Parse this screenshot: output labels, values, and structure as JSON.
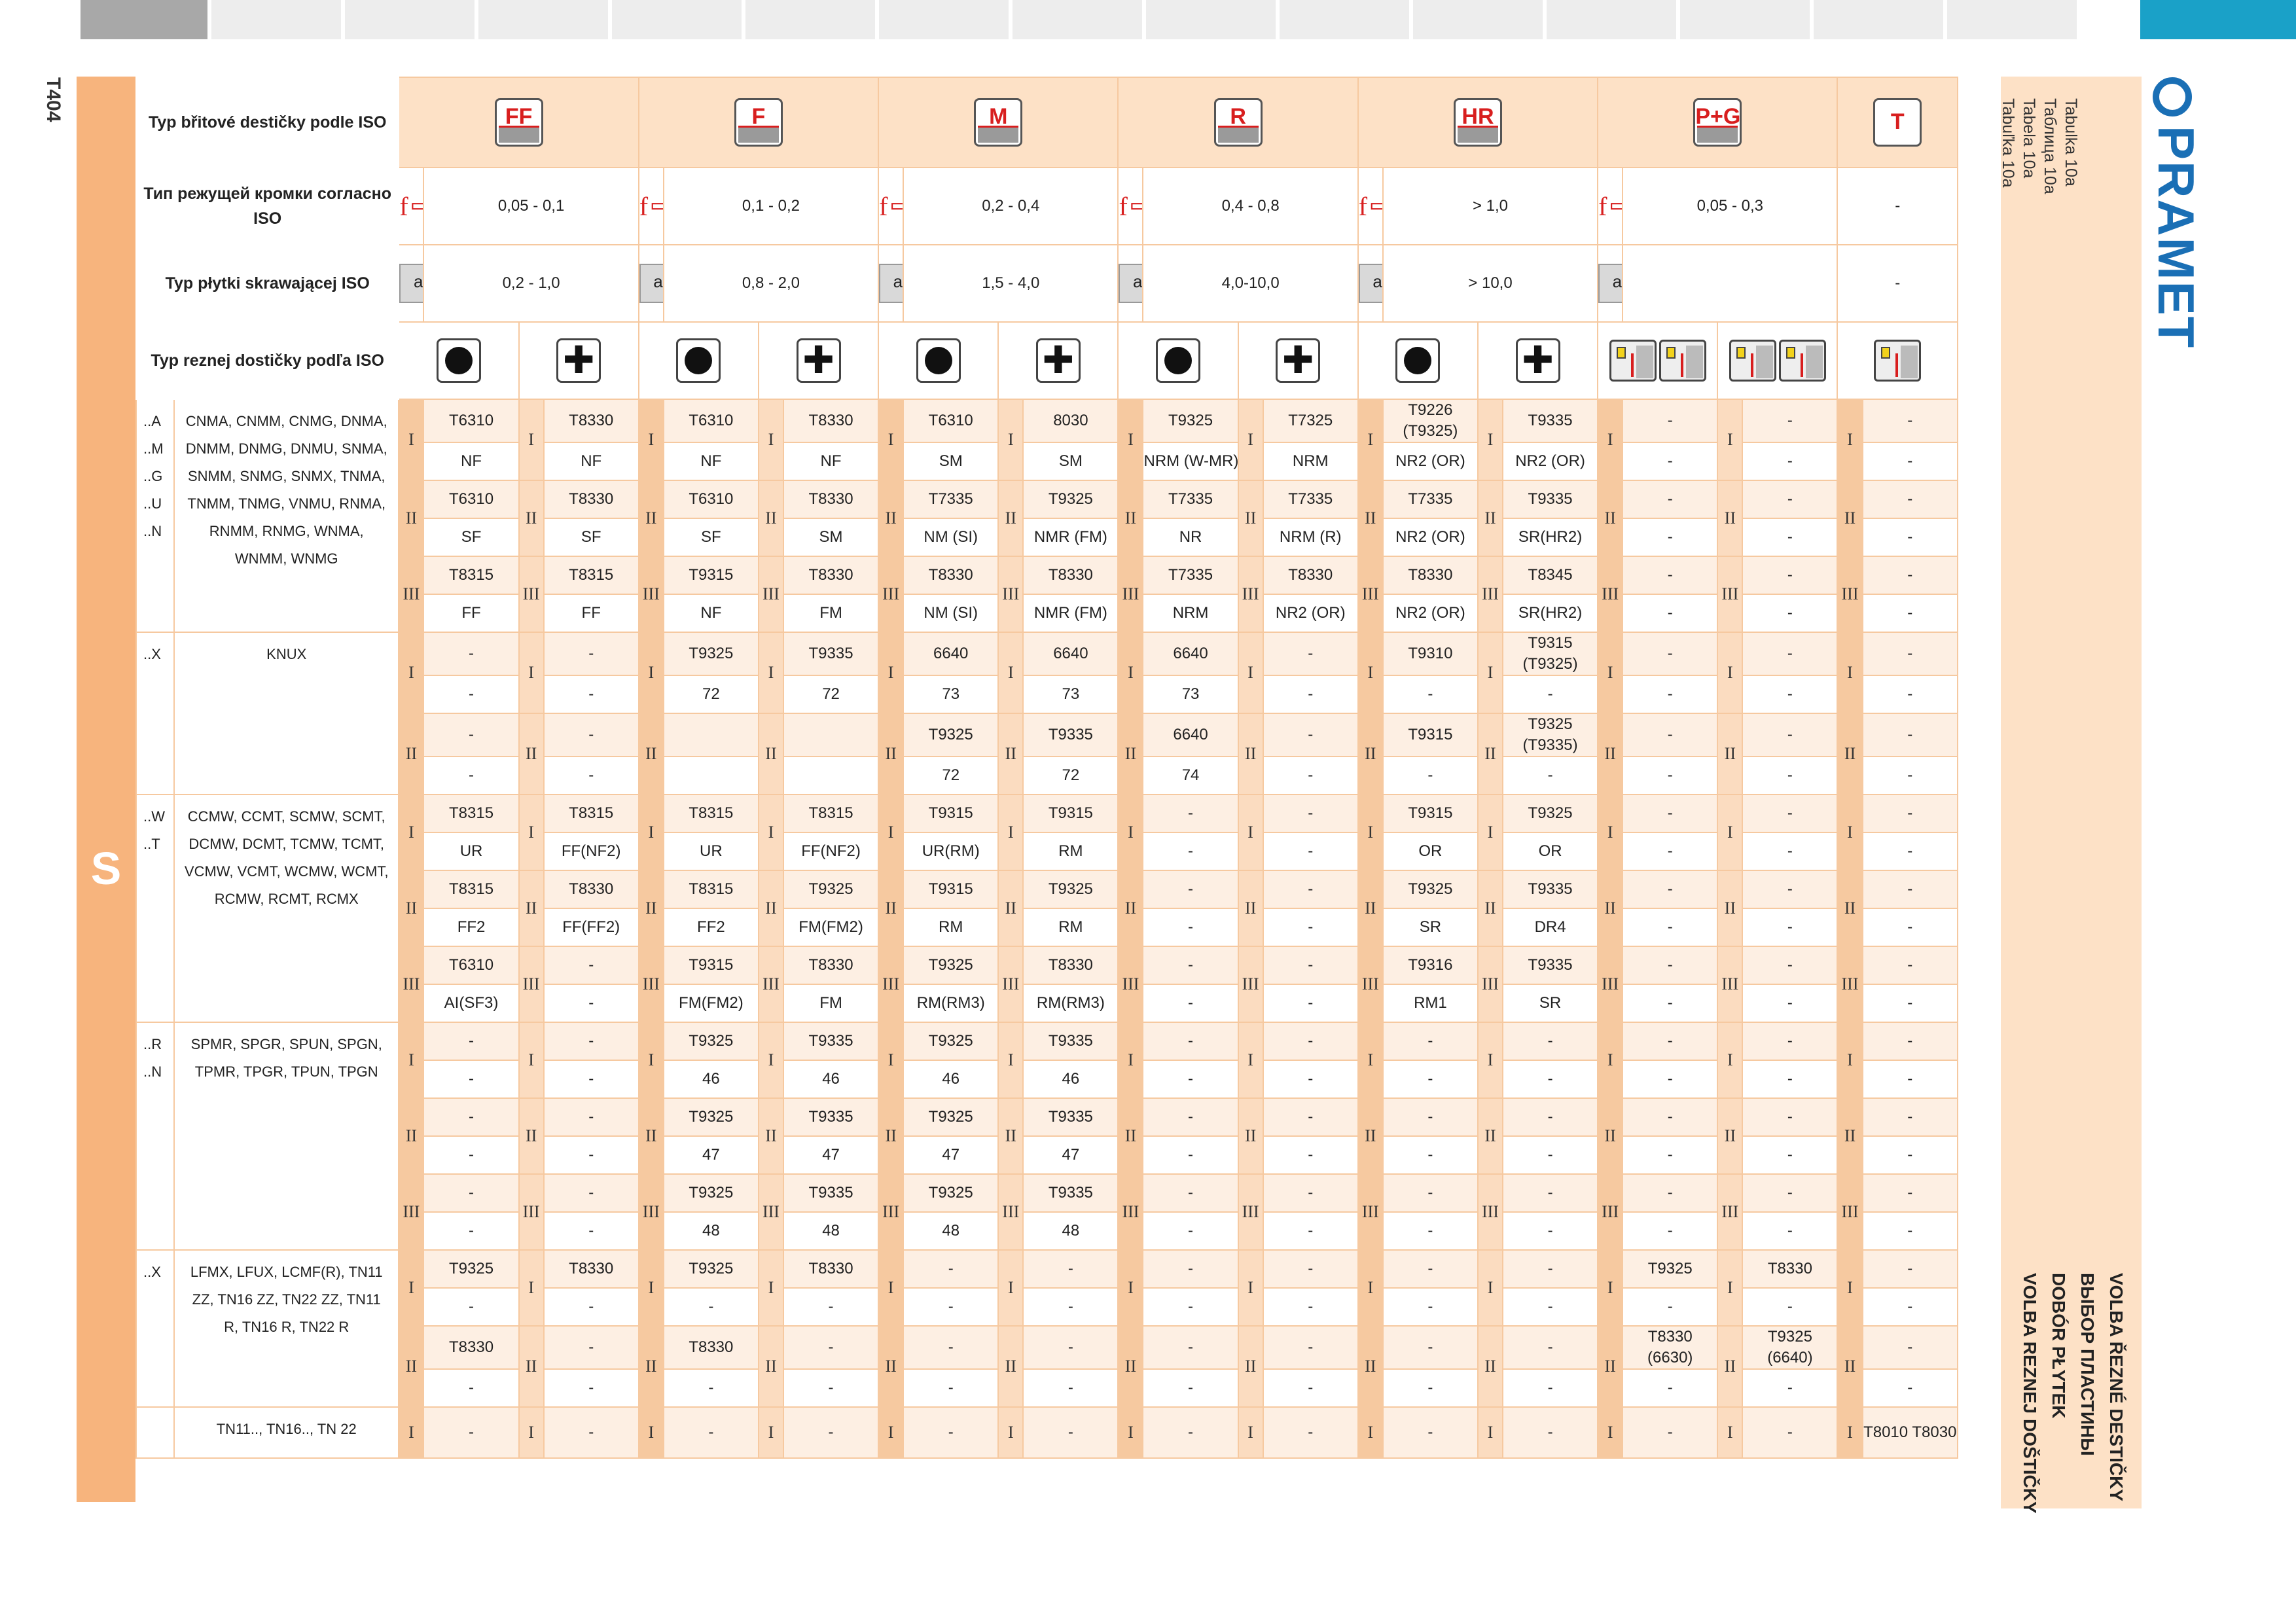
{
  "page": {
    "number": "T404",
    "side_letter": "S"
  },
  "brand": {
    "name": "PRAMET",
    "color": "#1a6fb5",
    "accent": "#1aa1c8",
    "band": "#f7b47d",
    "tint": "#fde1c6"
  },
  "table_refs": [
    "Tabulka 10a",
    "Таблица 10а",
    "Tabela 10a",
    "Tabuľka 10a"
  ],
  "section_titles": [
    "VOLBA ŘEZNÉ DESTIČKY",
    "ВЫБОР ПЛАСТИНЫ",
    "DOBÓR PŁYTEK",
    "VOLBA REZNEJ DOŠTIČKY"
  ],
  "header_labels": {
    "type_iso_cz": "Typ břitové destičky podle ISO",
    "type_iso_ru": "Тип режущей кромки согласно ISO",
    "type_iso_pl": "Typ płytki skrawającej ISO",
    "type_iso_sk": "Typ reznej dostičky podľa ISO"
  },
  "geometry_icons": [
    "FF",
    "F",
    "M",
    "R",
    "HR",
    "P+G",
    "T"
  ],
  "feed_symbol": "f",
  "depth_symbol": "ap",
  "feed_values": [
    "0,05 - 0,1",
    "0,1 - 0,2",
    "0,2 - 0,4",
    "0,4 - 0,8",
    "> 1,0",
    "0,05 - 0,3",
    "-"
  ],
  "depth_values": [
    "0,2 - 1,0",
    "0,8 - 2,0",
    "1,5 - 4,0",
    "4,0-10,0",
    "> 10,0",
    "",
    "-"
  ],
  "shape_icons": [
    "circle-icon",
    "cross-icon",
    "circle-icon",
    "cross-icon",
    "circle-icon",
    "cross-icon",
    "circle-icon",
    "cross-icon",
    "circle-icon",
    "cross-icon",
    "tool-icon",
    "tool-icon",
    "tool-icon"
  ],
  "groups": [
    {
      "codes": [
        "..A",
        "..M",
        "..G",
        "..U",
        "..N"
      ],
      "inserts": "CNMA, CNMM, CNMG, DNMA, DNMM, DNMG, DNMU, SNMA, SNMM, SNMG, SNMX, TNMA, TNMM, TNMG, VNMU, RNMA, RNMM, RNMG, WNMA, WNMM, WNMG",
      "levels": [
        {
          "level": "I",
          "grade": [
            "T6310",
            "T8330",
            "T6310",
            "T8330",
            "T6310",
            "8030",
            "T9325",
            "T7325",
            "T9226 (T9325)",
            "T9335",
            "-",
            "-",
            "-"
          ],
          "chip": [
            "NF",
            "NF",
            "NF",
            "NF",
            "SM",
            "SM",
            "NRM (W-MR)",
            "NRM",
            "NR2 (OR)",
            "NR2 (OR)",
            "-",
            "-",
            "-"
          ]
        },
        {
          "level": "II",
          "grade": [
            "T6310",
            "T8330",
            "T6310",
            "T8330",
            "T7335",
            "T9325",
            "T7335",
            "T7335",
            "T7335",
            "T9335",
            "-",
            "-",
            "-"
          ],
          "chip": [
            "SF",
            "SF",
            "SF",
            "SM",
            "NM (SI)",
            "NMR (FM)",
            "NR",
            "NRM (R)",
            "NR2 (OR)",
            "SR(HR2)",
            "-",
            "-",
            "-"
          ]
        },
        {
          "level": "III",
          "grade": [
            "T8315",
            "T8315",
            "T9315",
            "T8330",
            "T8330",
            "T8330",
            "T7335",
            "T8330",
            "T8330",
            "T8345",
            "-",
            "-",
            "-"
          ],
          "chip": [
            "FF",
            "FF",
            "NF",
            "FM",
            "NM (SI)",
            "NMR (FM)",
            "NRM",
            "NR2 (OR)",
            "NR2 (OR)",
            "SR(HR2)",
            "-",
            "-",
            "-"
          ]
        }
      ]
    },
    {
      "codes": [
        "..X"
      ],
      "inserts": "KNUX",
      "levels": [
        {
          "level": "I",
          "grade": [
            "-",
            "-",
            "T9325",
            "T9335",
            "6640",
            "6640",
            "6640",
            "-",
            "T9310",
            "T9315 (T9325)",
            "-",
            "-",
            "-"
          ],
          "chip": [
            "-",
            "-",
            "72",
            "72",
            "73",
            "73",
            "73",
            "-",
            "-",
            "-",
            "-",
            "-",
            "-"
          ]
        },
        {
          "level": "II",
          "grade": [
            "-",
            "-",
            "",
            "",
            "T9325",
            "T9335",
            "6640",
            "-",
            "T9315",
            "T9325 (T9335)",
            "-",
            "-",
            "-"
          ],
          "chip": [
            "-",
            "-",
            "",
            "",
            "72",
            "72",
            "74",
            "-",
            "-",
            "-",
            "-",
            "-",
            "-"
          ]
        }
      ]
    },
    {
      "codes": [
        "..W",
        "..T"
      ],
      "inserts": "CCMW, CCMT, SCMW, SCMT, DCMW, DCMT, TCMW, TCMT, VCMW, VCMT, WCMW, WCMT, RCMW, RCMT, RCMX",
      "levels": [
        {
          "level": "I",
          "grade": [
            "T8315",
            "T8315",
            "T8315",
            "T8315",
            "T9315",
            "T9315",
            "-",
            "-",
            "T9315",
            "T9325",
            "-",
            "-",
            "-"
          ],
          "chip": [
            "UR",
            "FF(NF2)",
            "UR",
            "FF(NF2)",
            "UR(RM)",
            "RM",
            "-",
            "-",
            "OR",
            "OR",
            "-",
            "-",
            "-"
          ]
        },
        {
          "level": "II",
          "grade": [
            "T8315",
            "T8330",
            "T8315",
            "T9325",
            "T9315",
            "T9325",
            "-",
            "-",
            "T9325",
            "T9335",
            "-",
            "-",
            "-"
          ],
          "chip": [
            "FF2",
            "FF(FF2)",
            "FF2",
            "FM(FM2)",
            "RM",
            "RM",
            "-",
            "-",
            "SR",
            "DR4",
            "-",
            "-",
            "-"
          ]
        },
        {
          "level": "III",
          "grade": [
            "T6310",
            "-",
            "T9315",
            "T8330",
            "T9325",
            "T8330",
            "-",
            "-",
            "T9316",
            "T9335",
            "-",
            "-",
            "-"
          ],
          "chip": [
            "AI(SF3)",
            "-",
            "FM(FM2)",
            "FM",
            "RM(RM3)",
            "RM(RM3)",
            "-",
            "-",
            "RM1",
            "SR",
            "-",
            "-",
            "-"
          ]
        }
      ]
    },
    {
      "codes": [
        "..R",
        "..N"
      ],
      "inserts": "SPMR, SPGR, SPUN, SPGN, TPMR, TPGR, TPUN, TPGN",
      "levels": [
        {
          "level": "I",
          "grade": [
            "-",
            "-",
            "T9325",
            "T9335",
            "T9325",
            "T9335",
            "-",
            "-",
            "-",
            "-",
            "-",
            "-",
            "-"
          ],
          "chip": [
            "-",
            "-",
            "46",
            "46",
            "46",
            "46",
            "-",
            "-",
            "-",
            "-",
            "-",
            "-",
            "-"
          ]
        },
        {
          "level": "II",
          "grade": [
            "-",
            "-",
            "T9325",
            "T9335",
            "T9325",
            "T9335",
            "-",
            "-",
            "-",
            "-",
            "-",
            "-",
            "-"
          ],
          "chip": [
            "-",
            "-",
            "47",
            "47",
            "47",
            "47",
            "-",
            "-",
            "-",
            "-",
            "-",
            "-",
            "-"
          ]
        },
        {
          "level": "III",
          "grade": [
            "-",
            "-",
            "T9325",
            "T9335",
            "T9325",
            "T9335",
            "-",
            "-",
            "-",
            "-",
            "-",
            "-",
            "-"
          ],
          "chip": [
            "-",
            "-",
            "48",
            "48",
            "48",
            "48",
            "-",
            "-",
            "-",
            "-",
            "-",
            "-",
            "-"
          ]
        }
      ]
    },
    {
      "codes": [
        "..X"
      ],
      "inserts": "LFMX, LFUX, LCMF(R), TN11 ZZ, TN16 ZZ, TN22 ZZ, TN11 R, TN16 R, TN22 R",
      "levels": [
        {
          "level": "I",
          "grade": [
            "T9325",
            "T8330",
            "T9325",
            "T8330",
            "-",
            "-",
            "-",
            "-",
            "-",
            "-",
            "T9325",
            "T8330",
            "-"
          ],
          "chip": [
            "-",
            "-",
            "-",
            "-",
            "-",
            "-",
            "-",
            "-",
            "-",
            "-",
            "-",
            "-",
            "-"
          ]
        },
        {
          "level": "II",
          "grade": [
            "T8330",
            "-",
            "T8330",
            "-",
            "-",
            "-",
            "-",
            "-",
            "-",
            "-",
            "T8330 (6630)",
            "T9325 (6640)",
            "-"
          ],
          "chip": [
            "-",
            "-",
            "-",
            "-",
            "-",
            "-",
            "-",
            "-",
            "-",
            "-",
            "-",
            "-",
            "-"
          ]
        }
      ]
    },
    {
      "codes": [
        ""
      ],
      "inserts": "TN11.., TN16.., TN 22",
      "single": {
        "level": "I",
        "values": [
          "-",
          "-",
          "-",
          "-",
          "-",
          "-",
          "-",
          "-",
          "-",
          "-",
          "-",
          "-",
          "T8010 T8030"
        ]
      }
    }
  ]
}
